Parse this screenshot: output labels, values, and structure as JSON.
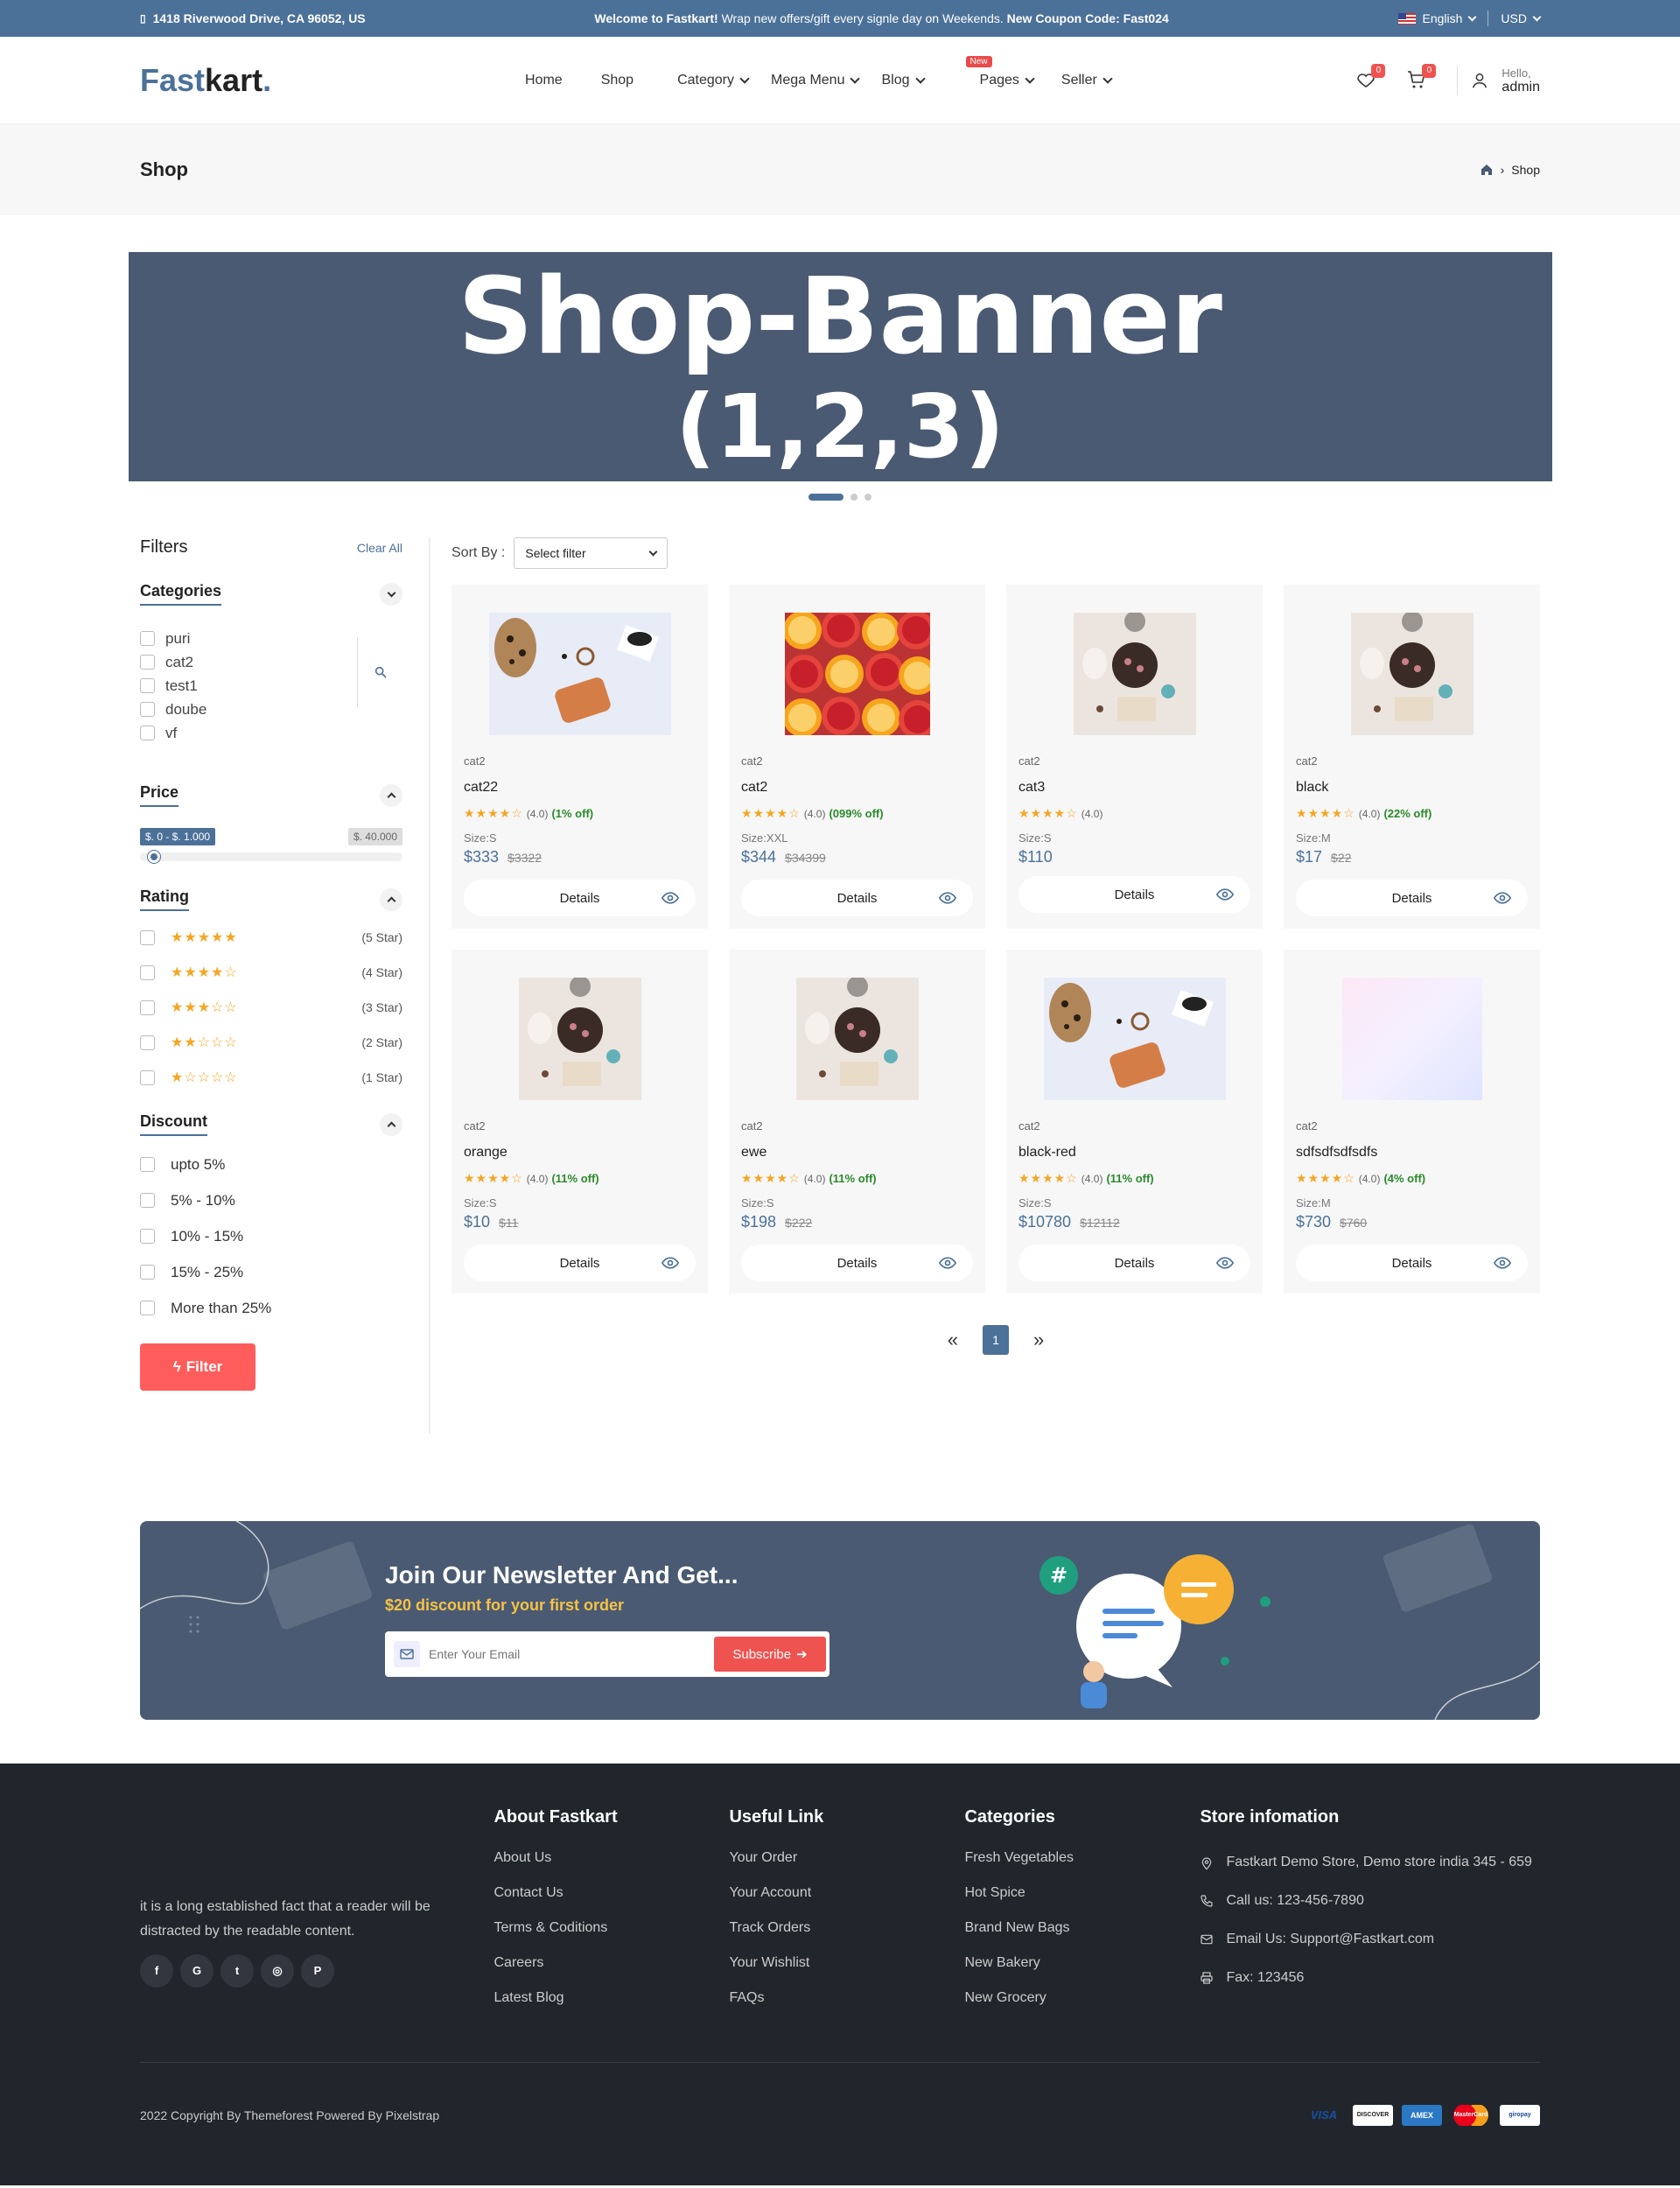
{
  "topbar": {
    "address": "1418 Riverwood Drive, CA 96052, US",
    "promo_bold1": "Welcome to Fastkart!",
    "promo_text": " Wrap new offers/gift every signle day on Weekends. ",
    "promo_bold2": "New Coupon Code: Fast024",
    "language": "English",
    "currency": "USD"
  },
  "header": {
    "logo_a": "Fast",
    "logo_b": "kart",
    "logo_dot": ".",
    "nav": [
      "Home",
      "Shop",
      "Category",
      "Mega Menu",
      "Blog",
      "Pages",
      "Seller"
    ],
    "new_badge": "New",
    "wishlist_count": "0",
    "cart_count": "0",
    "hello": "Hello,",
    "user": "admin"
  },
  "breadcrumb": {
    "title": "Shop",
    "current": "Shop"
  },
  "banner": {
    "line1": "Shop-Banner",
    "line2": "(1,2,3)"
  },
  "filters": {
    "title": "Filters",
    "clear": "Clear All",
    "categories_title": "Categories",
    "categories": [
      "puri",
      "cat2",
      "test1",
      "doube",
      "vf"
    ],
    "price_title": "Price",
    "price_range": "$. 0 - $. 1.000",
    "price_max": "$. 40.000",
    "price_fill": 0.03,
    "rating_title": "Rating",
    "ratings": [
      {
        "stars": "★★★★★",
        "label": "(5 Star)"
      },
      {
        "stars": "★★★★☆",
        "label": "(4 Star)"
      },
      {
        "stars": "★★★☆☆",
        "label": "(3 Star)"
      },
      {
        "stars": "★★☆☆☆",
        "label": "(2 Star)"
      },
      {
        "stars": "★☆☆☆☆",
        "label": "(1 Star)"
      }
    ],
    "discount_title": "Discount",
    "discounts": [
      "upto 5%",
      "5% - 10%",
      "10% - 15%",
      "15% - 25%",
      "More than 25%"
    ],
    "filter_button": "Filter"
  },
  "sort": {
    "label": "Sort By :",
    "value": "Select filter"
  },
  "products": [
    {
      "cat": "cat2",
      "name": "cat22",
      "rating": "(4.0)",
      "off": "(1% off)",
      "size": "Size:S",
      "price": "$333",
      "old": "$3322",
      "img": "bag",
      "btn": "Details"
    },
    {
      "cat": "cat2",
      "name": "cat2",
      "rating": "(4.0)",
      "off": "(099% off)",
      "size": "Size:XXL",
      "price": "$344",
      "old": "$34399",
      "img": "citrus",
      "btn": "Details"
    },
    {
      "cat": "cat2",
      "name": "cat3",
      "rating": "(4.0)",
      "off": "",
      "size": "Size:S",
      "price": "$110",
      "old": "",
      "img": "tea",
      "btn": "Details"
    },
    {
      "cat": "cat2",
      "name": "black",
      "rating": "(4.0)",
      "off": "(22% off)",
      "size": "Size:M",
      "price": "$17",
      "old": "$22",
      "img": "tea",
      "btn": "Details"
    },
    {
      "cat": "cat2",
      "name": "orange",
      "rating": "(4.0)",
      "off": "(11% off)",
      "size": "Size:S",
      "price": "$10",
      "old": "$11",
      "img": "tea",
      "btn": "Details"
    },
    {
      "cat": "cat2",
      "name": "ewe",
      "rating": "(4.0)",
      "off": "(11% off)",
      "size": "Size:S",
      "price": "$198",
      "old": "$222",
      "img": "tea",
      "btn": "Details"
    },
    {
      "cat": "cat2",
      "name": "black-red",
      "rating": "(4.0)",
      "off": "(11% off)",
      "size": "Size:S",
      "price": "$10780",
      "old": "$12112",
      "img": "bag",
      "btn": "Details"
    },
    {
      "cat": "cat2",
      "name": "sdfsdfsdfsdfs",
      "rating": "(4.0)",
      "off": "(4% off)",
      "size": "Size:M",
      "price": "$730",
      "old": "$760",
      "img": "gradient",
      "btn": "Details"
    }
  ],
  "pagination": {
    "prev": "«",
    "page": "1",
    "next": "»"
  },
  "newsletter": {
    "title": "Join Our Newsletter And Get...",
    "subtitle": "$20 discount for your first order",
    "placeholder": "Enter Your Email",
    "button": "Subscribe"
  },
  "footer": {
    "about_text": "it is a long established fact that a reader will be distracted by the readable content.",
    "social": [
      "f",
      "G",
      "t",
      "◎",
      "P"
    ],
    "about_title": "About Fastkart",
    "about_links": [
      "About Us",
      "Contact Us",
      "Terms & Coditions",
      "Careers",
      "Latest Blog"
    ],
    "useful_title": "Useful Link",
    "useful_links": [
      "Your Order",
      "Your Account",
      "Track Orders",
      "Your Wishlist",
      "FAQs"
    ],
    "categories_title": "Categories",
    "category_links": [
      "Fresh Vegetables",
      "Hot Spice",
      "Brand New Bags",
      "New Bakery",
      "New Grocery"
    ],
    "store_title": "Store infomation",
    "store_address": "Fastkart Demo Store, Demo store india 345 - 659",
    "store_phone": "Call us: 123-456-7890",
    "store_email": "Email Us: Support@Fastkart.com",
    "store_fax": "Fax: 123456",
    "copyright": "2022 Copyright By Themeforest Powered By Pixelstrap",
    "payments": [
      "VISA",
      "DISCOVER",
      "AMEX",
      "MasterCard",
      "giropay"
    ]
  },
  "colors": {
    "primary": "#4b7199",
    "accent": "#ef5350",
    "banner": "#4a5a72",
    "footer": "#21262d"
  }
}
